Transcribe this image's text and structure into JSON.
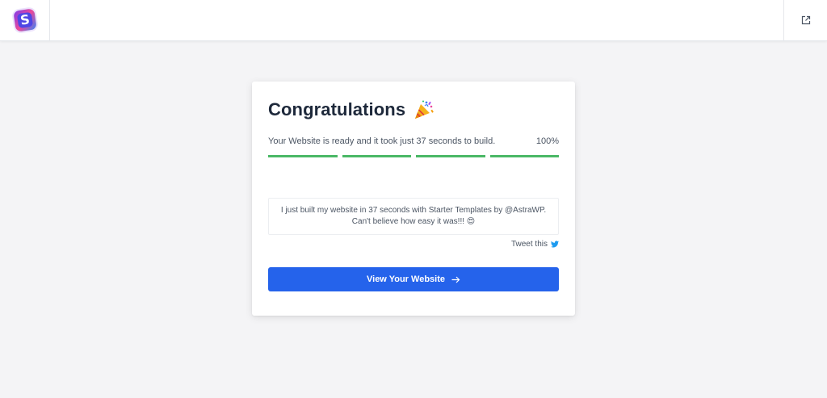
{
  "header": {
    "logo_letter": "S",
    "logo_icon": "starter-templates-logo-icon",
    "external_link_icon": "external-link-icon"
  },
  "card": {
    "title": "Congratulations",
    "title_icon": "party-popper-icon",
    "status_text": "Your Website is ready and it took just 37 seconds to build.",
    "percent_label": "100%",
    "progress": {
      "segments": [
        1.0,
        1.0,
        1.0,
        1.0
      ],
      "fill_color": "#4ab866",
      "track_color": "#e5e7eb"
    },
    "tweet": {
      "line1": "I just built my website in 37 seconds with Starter Templates by @AstraWP.",
      "line2": "Can't believe how easy it was!!! 😍",
      "link_label": "Tweet this",
      "link_icon": "twitter-icon"
    },
    "cta": {
      "label": "View Your Website",
      "icon": "arrow-right-icon",
      "color": "#2563eb"
    }
  },
  "colors": {
    "background": "#f4f4f6",
    "accent": "#2563eb",
    "success": "#4ab866",
    "twitter": "#1d9bf0"
  }
}
